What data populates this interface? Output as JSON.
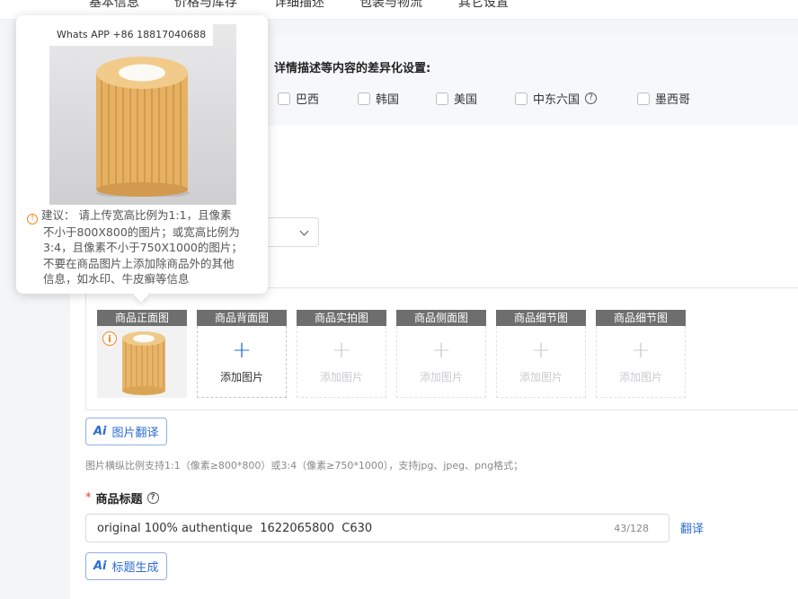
{
  "tabs": [
    "基本信息",
    "价格与库存",
    "详细描述",
    "包装与物流",
    "其它设置"
  ],
  "differentiation": {
    "title": "详情描述等内容的差异化设置:",
    "countries": [
      "巴西",
      "韩国",
      "美国",
      "中东六国",
      "墨西哥"
    ]
  },
  "image_slots": [
    {
      "label": "商品正面图",
      "state": "filled"
    },
    {
      "label": "商品背面图",
      "state": "active",
      "add_text": "添加图片"
    },
    {
      "label": "商品实拍图",
      "state": "disabled",
      "add_text": "添加图片"
    },
    {
      "label": "商品侧面图",
      "state": "disabled",
      "add_text": "添加图片"
    },
    {
      "label": "商品细节图",
      "state": "disabled",
      "add_text": "添加图片"
    },
    {
      "label": "商品细节图",
      "state": "disabled",
      "add_text": "添加图片"
    }
  ],
  "image_translate_button": "图片翻译",
  "ai_label": "Ai",
  "image_hint": "图片横纵比例支持1:1（像素≥800*800）或3:4（像素≥750*1000），支持jpg、jpeg、png格式；",
  "title_field": {
    "required_mark": "*",
    "label": "商品标题",
    "value": "original 100% authentique  1622065800  C630",
    "counter": "43/128",
    "translate_link": "翻译",
    "generate_button": "标题生成"
  },
  "tooltip": {
    "watermark": "Whats APP +86 18817040688",
    "lines": [
      "建议： 请上传宽高比例为1:1，且像素",
      "不小于800X800的图片；或宽高比例为",
      "3:4，且像素不小于750X1000的图片；",
      "不要在商品图片上添加除商品外的其他",
      "信息，如水印、牛皮癣等信息"
    ]
  },
  "colors": {
    "accent": "#2b6bd6",
    "warning": "#f08a24",
    "required": "#e23b3b"
  }
}
